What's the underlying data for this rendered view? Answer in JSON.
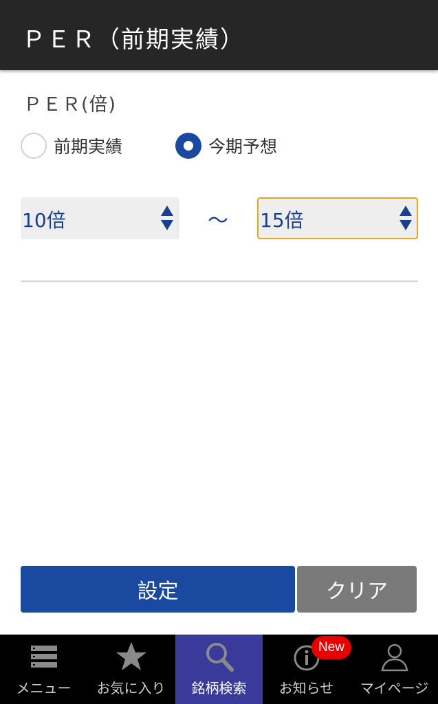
{
  "header": {
    "title": "ＰＥＲ（前期実績）"
  },
  "section": {
    "label": "ＰＥＲ(倍)"
  },
  "radios": {
    "previous": {
      "label": "前期実績",
      "checked": false
    },
    "forecast": {
      "label": "今期予想",
      "checked": true
    }
  },
  "range": {
    "from": {
      "value": "10倍"
    },
    "separator": "～",
    "to": {
      "value": "15倍"
    }
  },
  "buttons": {
    "set": "設定",
    "clear": "クリア"
  },
  "tabbar": {
    "items": [
      {
        "label": "メニュー",
        "icon": "menu-icon"
      },
      {
        "label": "お気に入り",
        "icon": "star-icon"
      },
      {
        "label": "銘柄検索",
        "icon": "search-icon",
        "active": true
      },
      {
        "label": "お知らせ",
        "icon": "info-icon"
      },
      {
        "label": "マイページ",
        "icon": "user-icon"
      }
    ],
    "badge": "New"
  },
  "colors": {
    "header_bg": "#262626",
    "accent_blue": "#1a4aa0",
    "select_text": "#1a3f8e",
    "focus_border": "#e0a820",
    "clear_button": "#7a7a7a",
    "tab_active": "#3a3a9a",
    "badge": "#e60000"
  }
}
